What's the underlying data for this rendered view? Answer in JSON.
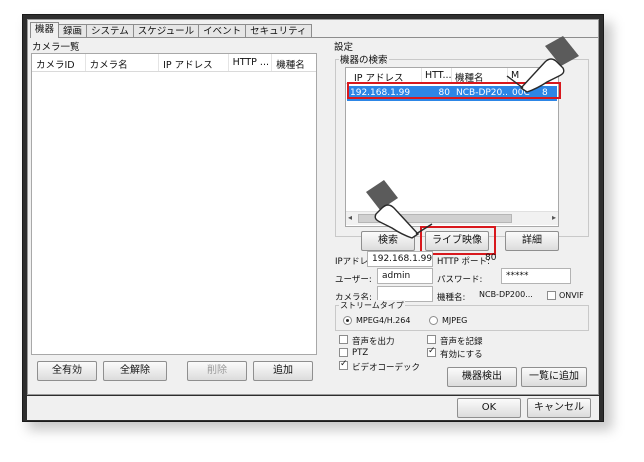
{
  "tabs": [
    "機器",
    "録画",
    "システム",
    "スケジュール",
    "イベント",
    "セキュリティ"
  ],
  "camera_list": {
    "title": "カメラ一覧",
    "columns": [
      "カメラID",
      "カメラ名",
      "IP アドレス",
      "HTTP ...",
      "機種名"
    ],
    "buttons": {
      "enable_all": "全有効",
      "disable_all": "全解除",
      "delete": "削除",
      "add": "追加"
    }
  },
  "settings": {
    "title": "設定",
    "search": {
      "title": "機器の検索",
      "columns": [
        "IP アドレス",
        "HTT...",
        "機種名",
        "M",
        "ス"
      ],
      "rows": [
        {
          "ip": "192.168.1.99",
          "port": "80",
          "model": "NCB-DP20...",
          "mac": "00C",
          "extra": "8"
        }
      ],
      "buttons": {
        "search": "検索",
        "live": "ライブ映像",
        "detail": "詳細"
      }
    },
    "fields": {
      "ip_label": "IPアドレス:",
      "ip_value": "192.168.1.99",
      "http_port_label": "HTTP ポート:",
      "http_port_value": "80",
      "user_label": "ユーザー:",
      "user_value": "admin",
      "password_label": "パスワード:",
      "password_value": "*****",
      "camera_name_label": "カメラ名:",
      "camera_name_value": "",
      "model_label": "機種名:",
      "model_value": "NCB-DP200...",
      "onvif_label": "ONVIF"
    },
    "stream": {
      "title": "ストリームタイプ",
      "options": [
        "MPEG4/H.264",
        "MJPEG"
      ],
      "selected": "MPEG4/H.264"
    },
    "checks": {
      "audio_out": "音声を出力",
      "ptz": "PTZ",
      "video_codec": "ビデオコーデック",
      "audio_rec": "音声を記録",
      "enable": "有効にする"
    },
    "buttons": {
      "detect": "機器検出",
      "add_batch": "一覧に追加"
    }
  },
  "dialog": {
    "ok": "OK",
    "cancel": "キャンセル"
  },
  "colors": {
    "highlight": "#2d86e6",
    "callout": "#d8181d"
  }
}
